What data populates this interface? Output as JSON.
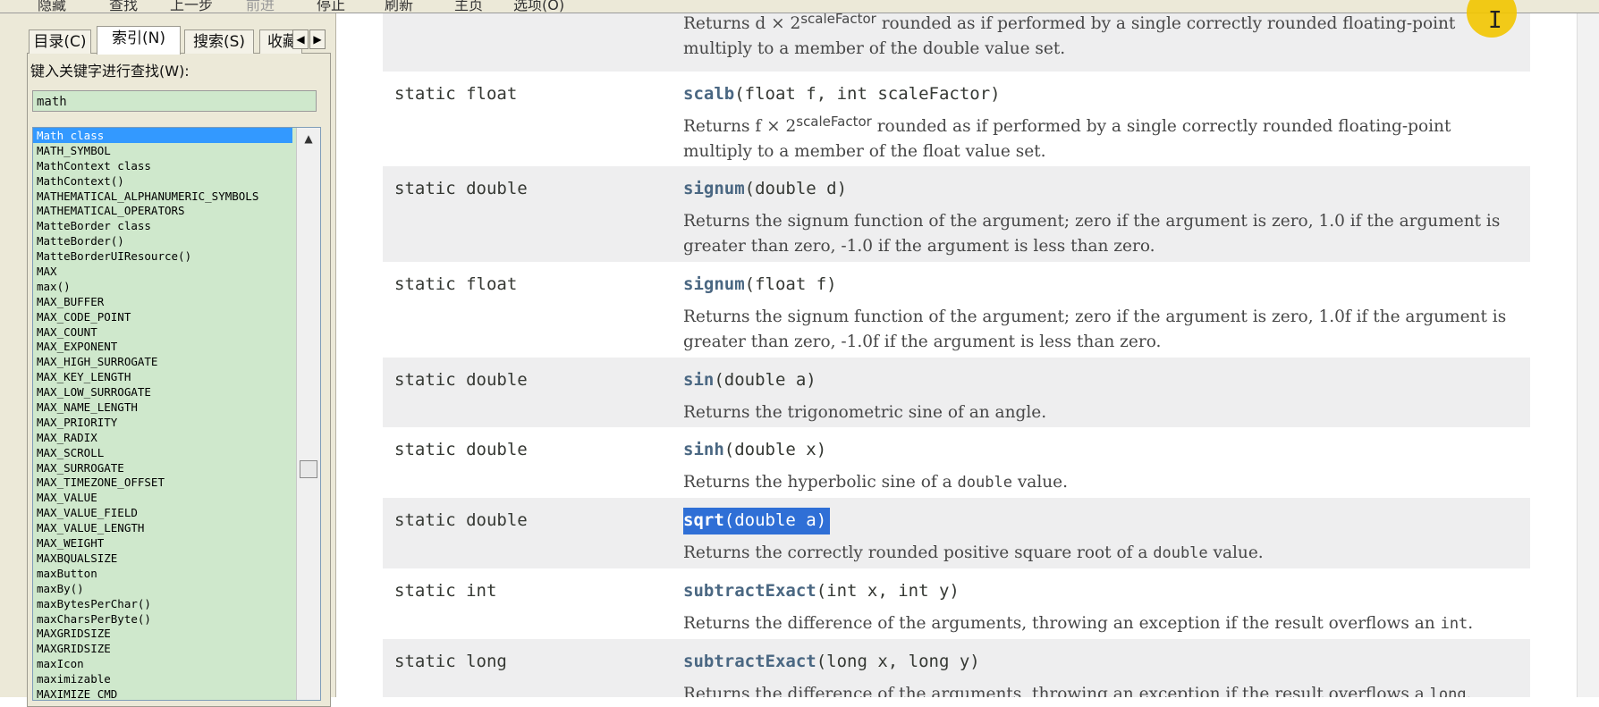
{
  "toolbar": [
    "隐藏",
    "查找",
    "上一步",
    "前进",
    "停止",
    "刷新",
    "主页",
    "选项(O)"
  ],
  "tabs": [
    "目录(C)",
    "索引(N)",
    "搜索(S)",
    "收藏"
  ],
  "search": {
    "label": "键入关键字进行查找(W):",
    "value": "math"
  },
  "index_items": [
    "Math class",
    "MATH_SYMBOL",
    "MathContext class",
    "MathContext()",
    "MATHEMATICAL_ALPHANUMERIC_SYMBOLS",
    "MATHEMATICAL_OPERATORS",
    "MatteBorder class",
    "MatteBorder()",
    "MatteBorderUIResource()",
    "MAX",
    "max()",
    "MAX_BUFFER",
    "MAX_CODE_POINT",
    "MAX_COUNT",
    "MAX_EXPONENT",
    "MAX_HIGH_SURROGATE",
    "MAX_KEY_LENGTH",
    "MAX_LOW_SURROGATE",
    "MAX_NAME_LENGTH",
    "MAX_PRIORITY",
    "MAX_RADIX",
    "MAX_SCROLL",
    "MAX_SURROGATE",
    "MAX_TIMEZONE_OFFSET",
    "MAX_VALUE",
    "MAX_VALUE_FIELD",
    "MAX_VALUE_LENGTH",
    "MAX_WEIGHT",
    "MAXBQUALSIZE",
    "maxButton",
    "maxBy()",
    "maxBytesPerChar()",
    "maxCharsPerByte()",
    "MAXGRIDSIZE",
    "MAXGRIDSIZE",
    "maxIcon",
    "maximizable",
    "MAXIMIZE_CMD"
  ],
  "top_desc": {
    "pre": "Returns d × 2",
    "sup": "scaleFactor",
    "post": " rounded as if performed by a single correctly rounded floating-point multiply to a member of the double value set."
  },
  "methods": [
    {
      "type": "static float",
      "name": "scalb",
      "params": "(float f, int scaleFactor)",
      "desc_pre": "Returns f × 2",
      "desc_sup": "scaleFactor",
      "desc_post": " rounded as if performed by a single correctly rounded floating-point multiply to a member of the float value set."
    },
    {
      "type": "static double",
      "name": "signum",
      "params": "(double d)",
      "desc": "Returns the signum function of the argument; zero if the argument is zero, 1.0 if the argument is greater than zero, -1.0 if the argument is less than zero."
    },
    {
      "type": "static float",
      "name": "signum",
      "params": "(float f)",
      "desc": "Returns the signum function of the argument; zero if the argument is zero, 1.0f if the argument is greater than zero, -1.0f if the argument is less than zero."
    },
    {
      "type": "static double",
      "name": "sin",
      "params": "(double a)",
      "desc": "Returns the trigonometric sine of an angle."
    },
    {
      "type": "static double",
      "name": "sinh",
      "params": "(double x)",
      "desc_pre": "Returns the hyperbolic sine of a ",
      "desc_code": "double",
      "desc_post": " value."
    },
    {
      "type": "static double",
      "name": "sqrt",
      "params": "(double a)",
      "desc_pre": "Returns the correctly rounded positive square root of a ",
      "desc_code": "double",
      "desc_post": " value."
    },
    {
      "type": "static int",
      "name": "subtractExact",
      "params": "(int x, int y)",
      "desc_pre": "Returns the difference of the arguments, throwing an exception if the result overflows an ",
      "desc_code": "int",
      "desc_post": "."
    },
    {
      "type": "static long",
      "name": "subtractExact",
      "params": "(long x, long y)",
      "desc_pre": "Returns the difference of the arguments, throwing an exception if the result overflows a ",
      "desc_code": "long",
      "desc_post": "."
    }
  ]
}
